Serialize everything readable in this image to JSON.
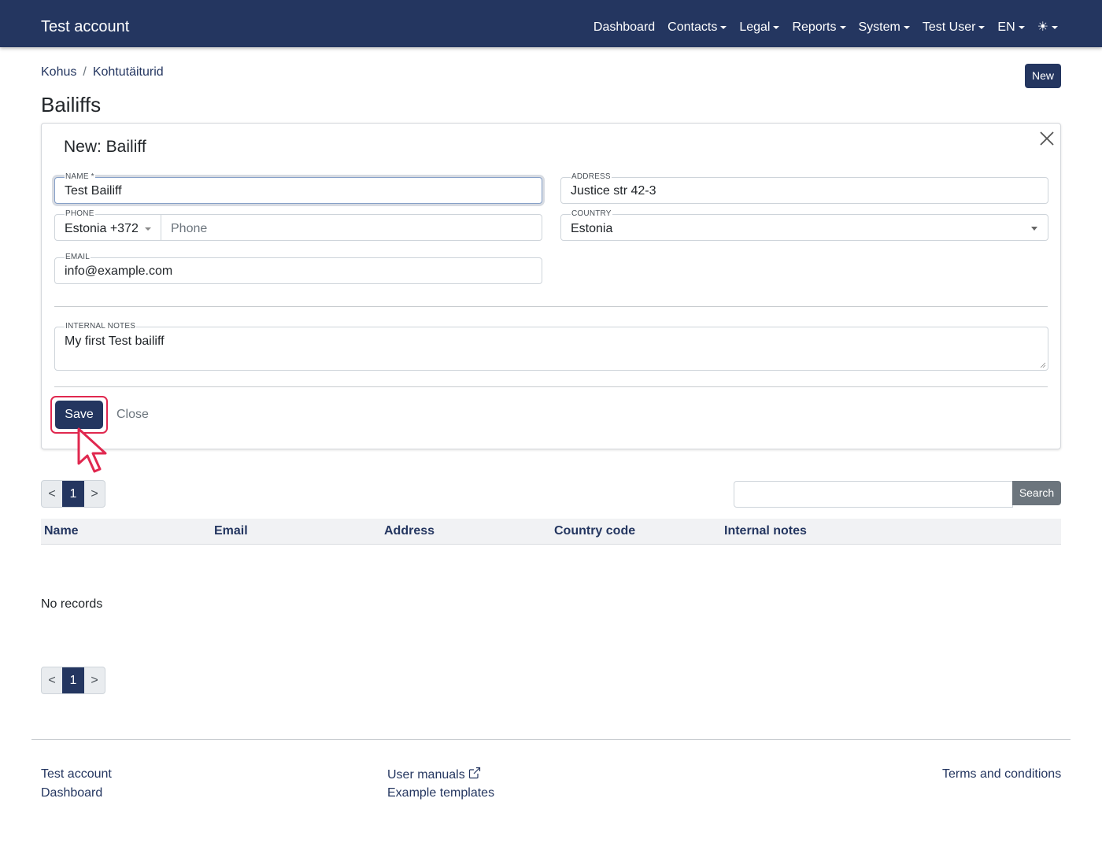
{
  "navbar": {
    "brand": "Test account",
    "items": [
      {
        "label": "Dashboard",
        "dropdown": false
      },
      {
        "label": "Contacts",
        "dropdown": true
      },
      {
        "label": "Legal",
        "dropdown": true
      },
      {
        "label": "Reports",
        "dropdown": true
      },
      {
        "label": "System",
        "dropdown": true
      },
      {
        "label": "Test User",
        "dropdown": true
      },
      {
        "label": "EN",
        "dropdown": true
      }
    ],
    "theme_icon": "☀",
    "theme_icon_name": "sun-icon"
  },
  "breadcrumb": [
    "Kohus",
    "Kohtutäiturid"
  ],
  "breadcrumb_separator": "/",
  "new_button": "New",
  "page_title": "Bailiffs",
  "form": {
    "title": "New: Bailiff",
    "close_icon": "close-icon",
    "name": {
      "label": "Name *",
      "value": "Test Bailiff"
    },
    "address": {
      "label": "Address",
      "value": "Justice str 42-3"
    },
    "phone": {
      "label": "Phone",
      "prefix": "Estonia +372",
      "placeholder": "Phone",
      "value": ""
    },
    "country": {
      "label": "Country",
      "value": "Estonia"
    },
    "email": {
      "label": "Email",
      "value": "info@example.com"
    },
    "notes": {
      "label": "Internal notes",
      "value": "My first Test bailiff"
    },
    "save": "Save",
    "close": "Close"
  },
  "pagination": {
    "prev": "<",
    "current": "1",
    "next": ">"
  },
  "search": {
    "value": "",
    "button": "Search"
  },
  "table": {
    "columns": [
      "Name",
      "Email",
      "Address",
      "Country code",
      "Internal notes"
    ],
    "rows": [],
    "empty_text": "No records"
  },
  "footer": {
    "col1": [
      "Test account",
      "Dashboard"
    ],
    "col2": [
      "User manuals",
      "Example templates"
    ],
    "col3": [
      "Terms and conditions"
    ]
  },
  "colors": {
    "primary": "#243660",
    "highlight": "#e0284f",
    "secondary": "#6c757d"
  }
}
